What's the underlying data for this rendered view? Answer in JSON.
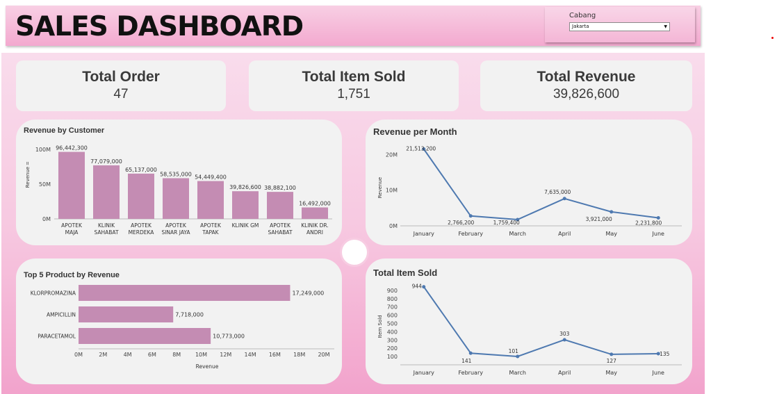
{
  "header": {
    "title": "SALES DASHBOARD"
  },
  "filter": {
    "label": "Cabang",
    "selected": "Jakarta"
  },
  "kpis": [
    {
      "title": "Total Order",
      "value": "47"
    },
    {
      "title": "Total Item Sold",
      "value": "1,751"
    },
    {
      "title": "Total Revenue",
      "value": "39,826,600"
    }
  ],
  "colors": {
    "bar": "#c48cb3",
    "line": "#4e79b0",
    "panel": "#f2f2f2"
  },
  "chart_data": [
    {
      "type": "bar",
      "title": "Revenue by Customer",
      "ylabel": "Revenue",
      "ylabel_suffix": "=",
      "ylim": [
        0,
        100000000
      ],
      "yticks": [
        "0M",
        "50M",
        "100M"
      ],
      "categories": [
        [
          "APOTEK",
          "MAJA"
        ],
        [
          "KLINIK",
          "SAHABAT"
        ],
        [
          "APOTEK",
          "MERDEKA"
        ],
        [
          "APOTEK",
          "SINAR JAYA"
        ],
        [
          "APOTEK",
          "TAPAK"
        ],
        [
          "KLINIK GM"
        ],
        [
          "APOTEK",
          "SAHABAT"
        ],
        [
          "KLINIK DR.",
          "ANDRI"
        ]
      ],
      "values": [
        96442300,
        77079000,
        65137000,
        58535000,
        54449400,
        39826600,
        38882100,
        16492000
      ],
      "labels": [
        "96,442,300",
        "77,079,000",
        "65,137,000",
        "58,535,000",
        "54,449,400",
        "39,826,600",
        "38,882,100",
        "16,492,000"
      ]
    },
    {
      "type": "line",
      "title": "Revenue per Month",
      "ylabel": "Revenue",
      "ylim": [
        0,
        22000000
      ],
      "yticks": [
        "0M",
        "10M",
        "20M"
      ],
      "categories": [
        "January",
        "February",
        "March",
        "April",
        "May",
        "June"
      ],
      "values": [
        21513200,
        2766200,
        1759400,
        7635000,
        3921000,
        2231800
      ],
      "labels": [
        "21,513,200",
        "2,766,200",
        "1,759,400",
        "7,635,000",
        "3,921,000",
        "2,231,800"
      ]
    },
    {
      "type": "bar",
      "orientation": "horizontal",
      "title": "Top 5 Product by Revenue",
      "xlabel": "Revenue",
      "xlim": [
        0,
        20000000
      ],
      "xticks": [
        "0M",
        "2M",
        "4M",
        "6M",
        "8M",
        "10M",
        "12M",
        "14M",
        "16M",
        "18M",
        "20M"
      ],
      "categories": [
        "KLORPROMAZINA",
        "AMPICILLIN",
        "PARACETAMOL"
      ],
      "values": [
        17249000,
        7718000,
        10773000
      ],
      "labels": [
        "17,249,000",
        "7,718,000",
        "10,773,000"
      ]
    },
    {
      "type": "line",
      "title": "Total Item Sold",
      "ylabel": "Item Sold",
      "ylim": [
        0,
        950
      ],
      "yticks": [
        "100",
        "200",
        "300",
        "400",
        "500",
        "600",
        "700",
        "800",
        "900"
      ],
      "categories": [
        "January",
        "February",
        "March",
        "April",
        "May",
        "June"
      ],
      "values": [
        944,
        141,
        101,
        303,
        127,
        135
      ],
      "labels": [
        "944",
        "141",
        "101",
        "303",
        "127",
        "135"
      ]
    }
  ]
}
